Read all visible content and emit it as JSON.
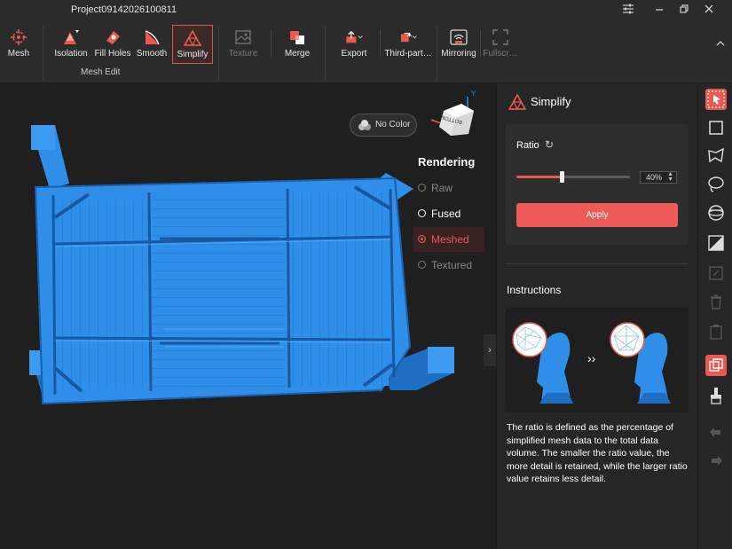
{
  "window": {
    "title": "Project09142026100811"
  },
  "toolbar": {
    "mesh": "Mesh",
    "isolation": "Isolation",
    "fill_holes": "Fill Holes",
    "smooth": "Smooth",
    "simplify": "Simplify",
    "texture": "Texture",
    "merge": "Merge",
    "export": "Export",
    "third_party": "Third-part…",
    "mirroring": "Mirroring",
    "fullscreen": "Fullscr…",
    "group_mesh_edit": "Mesh Edit"
  },
  "viewport": {
    "no_color": "No Color",
    "rendering_title": "Rendering",
    "rendering_options": [
      "Raw",
      "Fused",
      "Meshed",
      "Textured"
    ],
    "rendering_selected": "Meshed",
    "cube_label": "BOTTOM",
    "axis_y": "Y"
  },
  "panel": {
    "title": "Simplify",
    "ratio_label": "Ratio",
    "ratio_value": "40%",
    "ratio_fraction": 0.4,
    "apply_label": "Apply",
    "instructions_title": "Instructions",
    "instructions_text": "The ratio is defined as the percentage of simplified mesh data to the total data volume. The smaller the ratio value, the more detail is retained, while the larger ratio value retains less detail."
  },
  "colors": {
    "accent": "#e8594f",
    "mesh": "#2f8ee8",
    "background": "#1f1f1f"
  }
}
